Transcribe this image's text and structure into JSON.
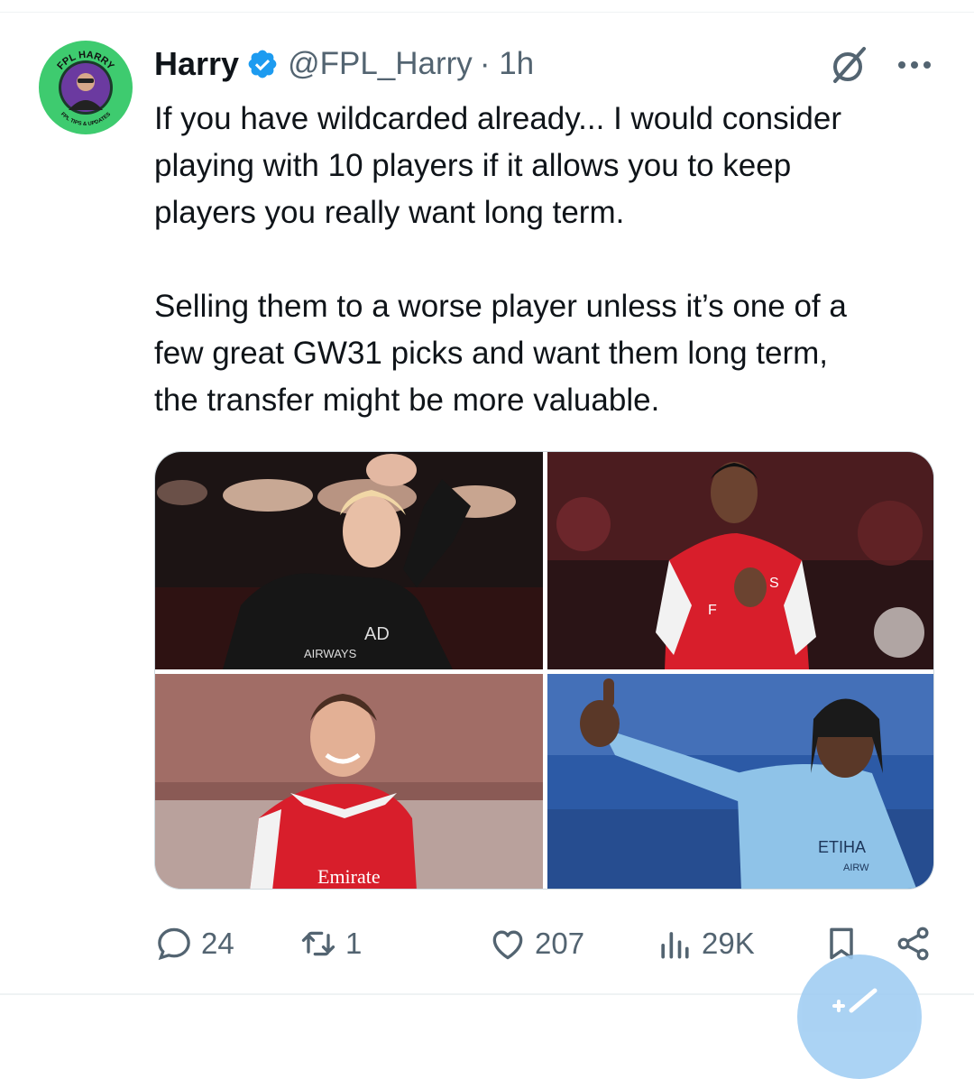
{
  "tweet": {
    "author": {
      "name": "Harry",
      "handle": "@FPL_Harry",
      "time": "· 1h",
      "verified": true,
      "avatar_top_text": "FPL HARRY",
      "avatar_bottom_text": "FPL TIPS & UPDATES"
    },
    "paragraphs": [
      [
        "If you have wildcarded already... I would consider",
        "playing with 10 players if it allows you to keep",
        "players you really want long term."
      ],
      [
        "Selling them to a worse player unless it’s one of a",
        "few great GW31 picks and want them long term,",
        "the transfer might be more valuable."
      ]
    ],
    "media": {
      "photo1": {
        "sponsor_line1": "AD",
        "sponsor_line2": "AIRWAYS"
      },
      "photo2": {
        "sponsor_line1": "F",
        "sponsor_line2": "S"
      },
      "photo3": {
        "sponsor": "Emirate"
      },
      "photo4": {
        "sponsor_line1": "ETIHA",
        "sponsor_line2": "AIRW"
      }
    },
    "metrics": {
      "replies": "24",
      "retweets": "1",
      "likes": "207",
      "views": "29K"
    }
  },
  "colors": {
    "text": "#0f1419",
    "secondary": "#536471",
    "verified": "#1d9bf0",
    "avatar_ring": "#3ecb6f",
    "arsenal_red": "#d81e2b",
    "city_blue": "#8fc3e8"
  },
  "icons": [
    "verified-badge-icon",
    "grok-icon",
    "more-icon",
    "reply-icon",
    "retweet-icon",
    "like-icon",
    "views-icon",
    "bookmark-icon",
    "share-icon",
    "compose-icon"
  ]
}
